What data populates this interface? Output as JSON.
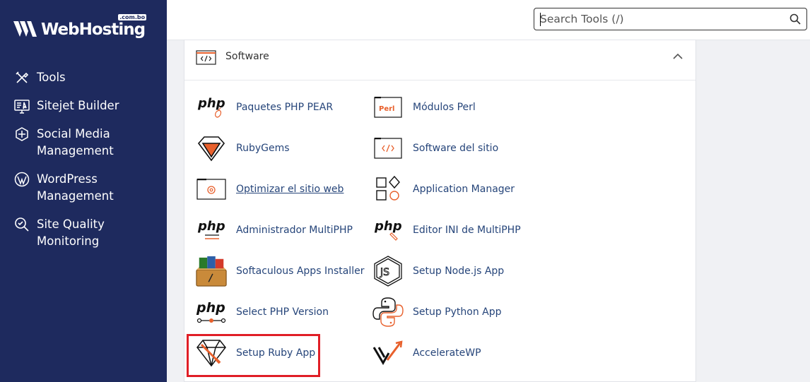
{
  "brand": {
    "name": "WebHosting",
    "tld": ".com.bo"
  },
  "sidebar": {
    "items": [
      {
        "label": "Tools",
        "icon": "tools-icon"
      },
      {
        "label": "Sitejet Builder",
        "icon": "sitejet-icon"
      },
      {
        "label": "Social Media Management",
        "icon": "social-media-icon"
      },
      {
        "label": "WordPress Management",
        "icon": "wordpress-icon"
      },
      {
        "label": "Site Quality Monitoring",
        "icon": "site-quality-icon"
      }
    ]
  },
  "search": {
    "placeholder": "Search Tools (/)"
  },
  "panel": {
    "title": "Software",
    "tools": [
      {
        "label": "Paquetes PHP PEAR",
        "icon": "php-pear-icon"
      },
      {
        "label": "Módulos Perl",
        "icon": "perl-icon"
      },
      {
        "label": "RubyGems",
        "icon": "rubygems-icon"
      },
      {
        "label": "Software del sitio",
        "icon": "site-software-icon"
      },
      {
        "label": "Optimizar el sitio web",
        "icon": "optimize-website-icon"
      },
      {
        "label": "Application Manager",
        "icon": "application-manager-icon"
      },
      {
        "label": "Administrador MultiPHP",
        "icon": "multiphp-manager-icon"
      },
      {
        "label": "Editor INI de MultiPHP",
        "icon": "multiphp-ini-editor-icon"
      },
      {
        "label": "Softaculous Apps Installer",
        "icon": "softaculous-icon"
      },
      {
        "label": "Setup Node.js App",
        "icon": "nodejs-icon"
      },
      {
        "label": "Select PHP Version",
        "icon": "select-php-version-icon"
      },
      {
        "label": "Setup Python App",
        "icon": "python-icon"
      },
      {
        "label": "Setup Ruby App",
        "icon": "ruby-app-icon"
      },
      {
        "label": "AccelerateWP",
        "icon": "acceleratewp-icon"
      }
    ],
    "icon_text": {
      "php": "php",
      "perl": "Perl"
    }
  },
  "colors": {
    "sidebar": "#1e2a5e",
    "link": "#26457a",
    "accent": "#e8602c",
    "highlight": "#e01e26"
  }
}
